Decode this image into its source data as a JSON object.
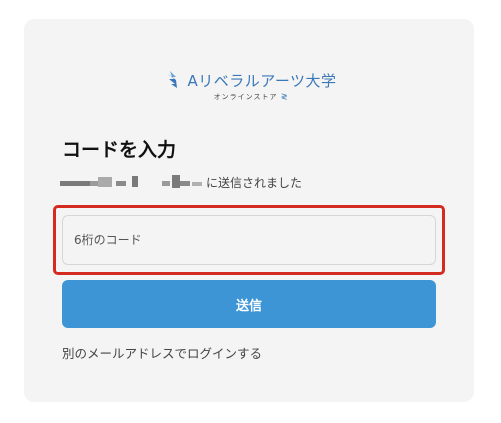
{
  "logo": {
    "name": "Aリベラルアーツ大学",
    "subtitle": "オンラインストア",
    "mark_icon": "brand-wing-icon",
    "color": "#3a78b8"
  },
  "title": "コードを入力",
  "sent_message": "に送信されました",
  "code_field": {
    "placeholder": "6桁のコード",
    "value": ""
  },
  "send_button_label": "送信",
  "alt_login_link": "別のメールアドレスでログインする",
  "colors": {
    "accent": "#3d95d6",
    "highlight": "#d42a20",
    "card_background": "#f4f4f4"
  }
}
